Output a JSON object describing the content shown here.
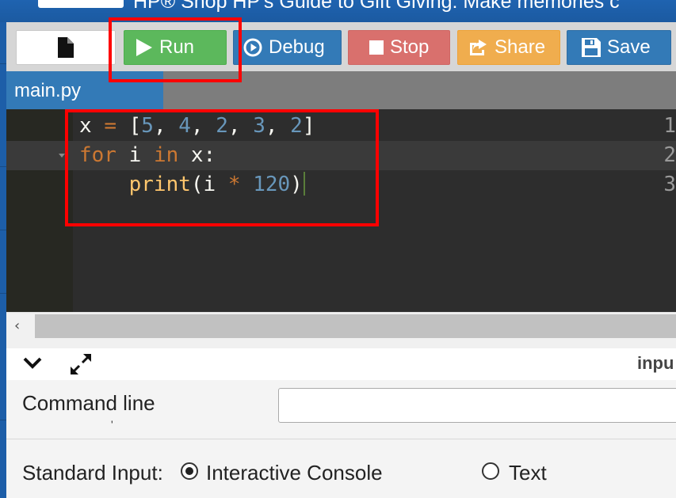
{
  "banner": {
    "text": "HP® Shop HP's Guide to Gift Giving: Make memories c"
  },
  "toolbar": {
    "run_label": "Run",
    "debug_label": "Debug",
    "stop_label": "Stop",
    "share_label": "Share",
    "save_label": "Save"
  },
  "tabs": {
    "active": "main.py"
  },
  "editor": {
    "line_numbers": [
      "1",
      "2",
      "3"
    ],
    "lines": [
      [
        {
          "t": "x ",
          "c": "pl"
        },
        {
          "t": "=",
          "c": "op"
        },
        {
          "t": " [",
          "c": "pl"
        },
        {
          "t": "5",
          "c": "num"
        },
        {
          "t": ", ",
          "c": "pl"
        },
        {
          "t": "4",
          "c": "num"
        },
        {
          "t": ", ",
          "c": "pl"
        },
        {
          "t": "2",
          "c": "num"
        },
        {
          "t": ", ",
          "c": "pl"
        },
        {
          "t": "3",
          "c": "num"
        },
        {
          "t": ", ",
          "c": "pl"
        },
        {
          "t": "2",
          "c": "num"
        },
        {
          "t": "]",
          "c": "pl"
        }
      ],
      [
        {
          "t": "for",
          "c": "kw"
        },
        {
          "t": " i ",
          "c": "pl"
        },
        {
          "t": "in",
          "c": "kw"
        },
        {
          "t": " x:",
          "c": "pl"
        }
      ],
      [
        {
          "t": "    ",
          "c": "pl"
        },
        {
          "t": "print",
          "c": "fn"
        },
        {
          "t": "(i ",
          "c": "pl"
        },
        {
          "t": "*",
          "c": "op"
        },
        {
          "t": " ",
          "c": "pl"
        },
        {
          "t": "120",
          "c": "num"
        },
        {
          "t": ")",
          "c": "pl"
        }
      ]
    ]
  },
  "panel": {
    "input_tab_label": "inpu",
    "command_line_label": "Command line",
    "command_line_label_overflow": "'",
    "command_line_value": "",
    "stdin_label": "Standard Input:",
    "option_interactive": "Interactive Console",
    "option_text": "Text",
    "selected": "interactive"
  }
}
